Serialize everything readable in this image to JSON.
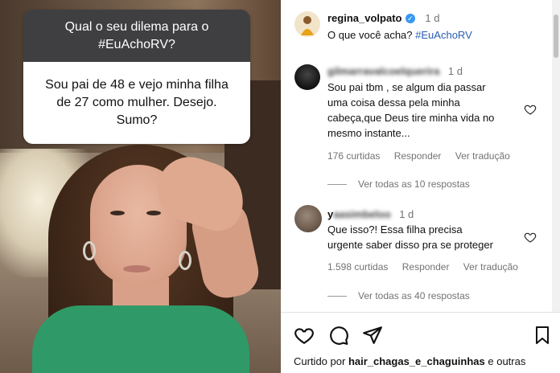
{
  "story": {
    "question_title": "Qual o seu dilema para o #EuAchoRV?",
    "question_line1": "Qual o seu dilema para o",
    "question_line2": "#EuAchoRV?",
    "answer_line1": "Sou pai de 48 e vejo minha filha",
    "answer_line2": "de 27 como mulher. Desejo.",
    "answer_line3": "Sumo?"
  },
  "post": {
    "username": "regina_volpato",
    "time": "1 d",
    "caption": "O que você acha?",
    "hashtag": "#EuAchoRV"
  },
  "comments": [
    {
      "username": "gilmarravalcoelquerira",
      "time": "1 d",
      "text_line1": "Sou pai tbm , se algum dia passar",
      "text_line2": "uma coisa dessa pela minha",
      "text_line3": "cabeça,que Deus tire minha vida no",
      "text_line4": "mesmo instante...",
      "likes": "176 curtidas",
      "reply": "Responder",
      "translate": "Ver tradução",
      "view_replies": "Ver todas as 10 respostas"
    },
    {
      "username_prefix": "y",
      "username_rest": "aasimbeloo",
      "time": "1 d",
      "text_line1": "Que isso?! Essa filha precisa",
      "text_line2": "urgente saber disso pra se proteger",
      "likes": "1.598 curtidas",
      "reply": "Responder",
      "translate": "Ver tradução",
      "view_replies": "Ver todas as 40 respostas"
    }
  ],
  "footer": {
    "liked_by_prefix": "Curtido por",
    "liked_by_user": "hair_chagas_e_chaguinhas",
    "liked_by_suffix": "e outras"
  },
  "icons": [
    "heart-icon",
    "comment-icon",
    "share-icon",
    "bookmark-icon",
    "verified-icon"
  ],
  "colors": {
    "hashtag": "#2a5db0",
    "verified": "#3897f0",
    "card_header": "#3f3f42",
    "shirt": "#2f9a67"
  }
}
